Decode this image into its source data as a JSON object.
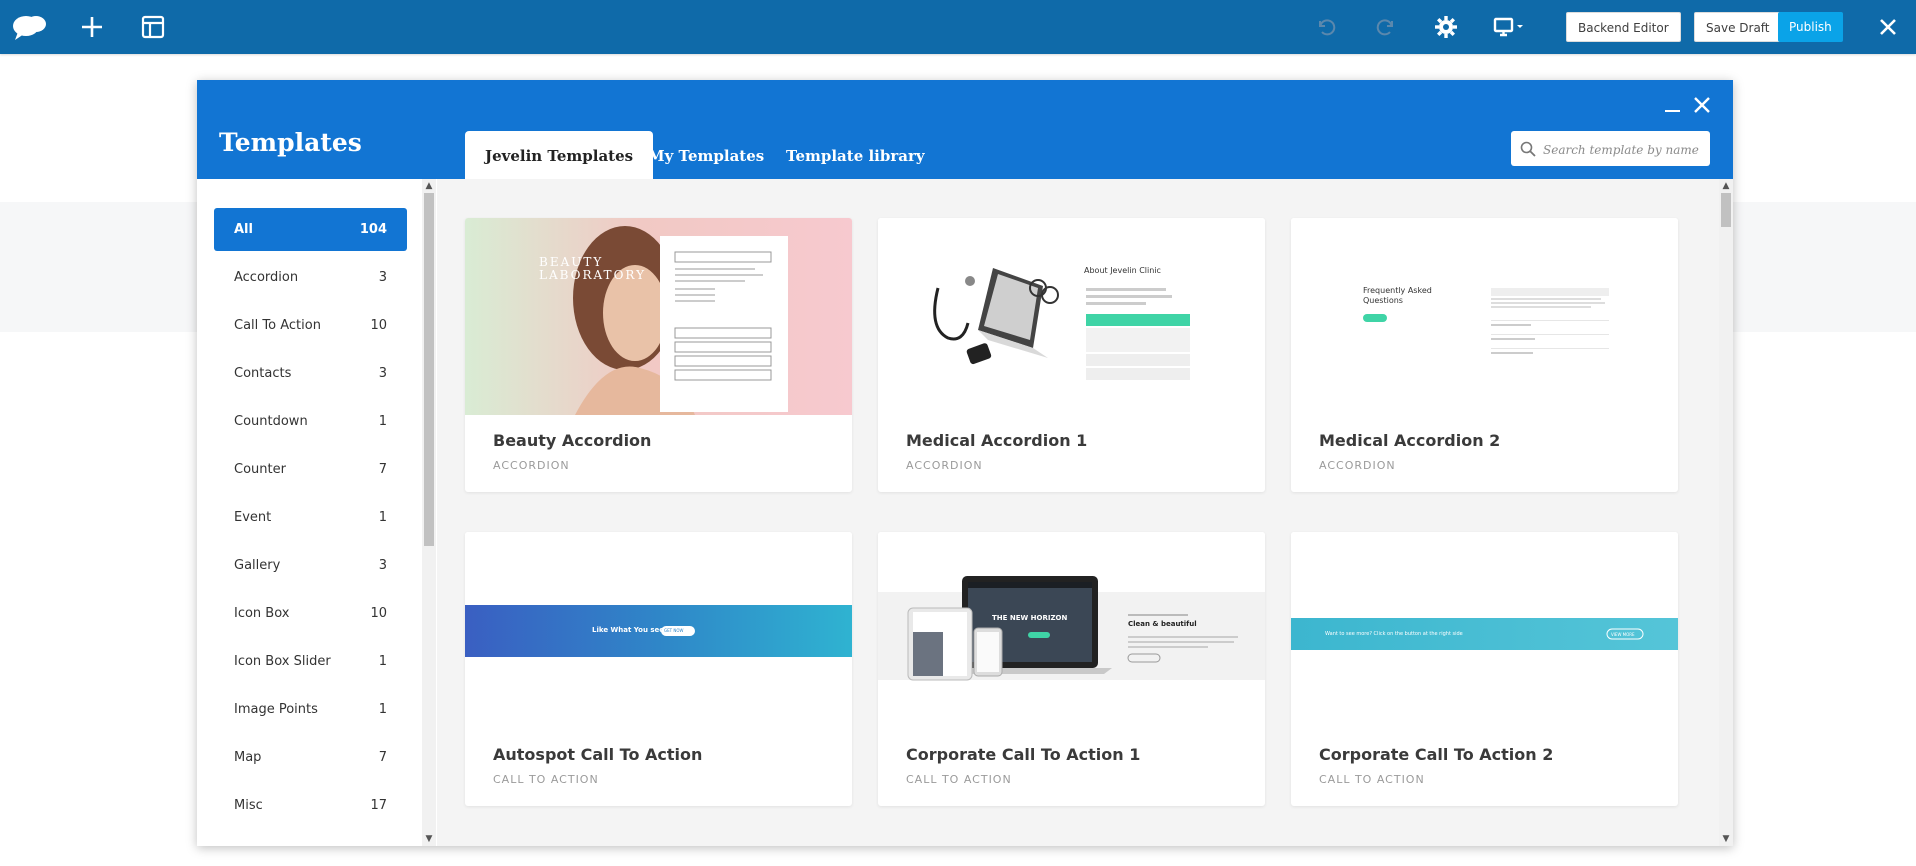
{
  "toolbar": {
    "backend_editor": "Backend Editor",
    "save_draft": "Save Draft",
    "publish": "Publish",
    "colors": {
      "bar": "#0f6aa9",
      "publish": "#0aa3e8"
    }
  },
  "modal": {
    "title": "Templates",
    "tabs": [
      {
        "label": "Jevelin Templates",
        "active": true
      },
      {
        "label": "My Templates",
        "active": false
      },
      {
        "label": "Template library",
        "active": false
      }
    ],
    "search_placeholder": "Search template by name",
    "accent": "#1275d3"
  },
  "sidebar": {
    "items": [
      {
        "label": "All",
        "count": "104",
        "active": true
      },
      {
        "label": "Accordion",
        "count": "3"
      },
      {
        "label": "Call To Action",
        "count": "10"
      },
      {
        "label": "Contacts",
        "count": "3"
      },
      {
        "label": "Countdown",
        "count": "1"
      },
      {
        "label": "Counter",
        "count": "7"
      },
      {
        "label": "Event",
        "count": "1"
      },
      {
        "label": "Gallery",
        "count": "3"
      },
      {
        "label": "Icon Box",
        "count": "10"
      },
      {
        "label": "Icon Box Slider",
        "count": "1"
      },
      {
        "label": "Image Points",
        "count": "1"
      },
      {
        "label": "Map",
        "count": "7"
      },
      {
        "label": "Misc",
        "count": "17"
      }
    ]
  },
  "templates": [
    {
      "name": "Beauty Accordion",
      "category": "ACCORDION",
      "preview": {
        "heading": "BEAUTY LABORATORY"
      }
    },
    {
      "name": "Medical Accordion 1",
      "category": "ACCORDION",
      "preview": {
        "heading": "About Jevelin Clinic"
      }
    },
    {
      "name": "Medical Accordion 2",
      "category": "ACCORDION",
      "preview": {
        "heading": "Frequently Asked Questions"
      }
    },
    {
      "name": "Autospot Call To Action",
      "category": "CALL TO ACTION",
      "preview": {
        "text": "Like What You see?",
        "button": "GET NOW"
      }
    },
    {
      "name": "Corporate Call To Action 1",
      "category": "CALL TO ACTION",
      "preview": {
        "screen_text": "THE NEW HORIZON",
        "heading": "Clean & beautiful"
      }
    },
    {
      "name": "Corporate Call To Action 2",
      "category": "CALL TO ACTION",
      "preview": {
        "text": "Want to see more? Click on the button at the right side",
        "button": "VIEW MORE"
      }
    }
  ]
}
